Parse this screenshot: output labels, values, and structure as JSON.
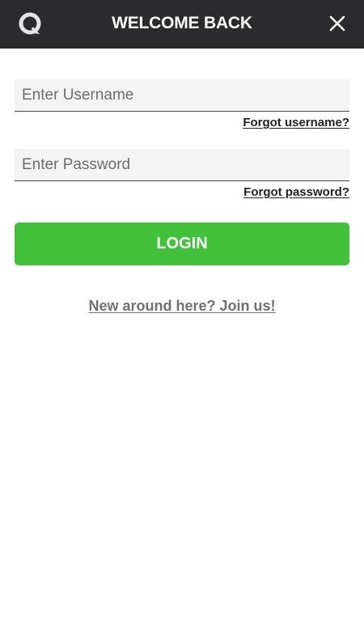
{
  "header": {
    "title": "WELCOME BACK",
    "logo_icon": "brand-logo-icon",
    "close_icon": "close-icon",
    "background_color": "#2b2b2e"
  },
  "form": {
    "username": {
      "placeholder": "Enter Username",
      "value": ""
    },
    "forgot_username": "Forgot username?",
    "password": {
      "placeholder": "Enter Password",
      "value": ""
    },
    "forgot_password": "Forgot password?",
    "login_label": "LOGIN",
    "login_color": "#42c13a"
  },
  "join_link": "New around here? Join us!"
}
